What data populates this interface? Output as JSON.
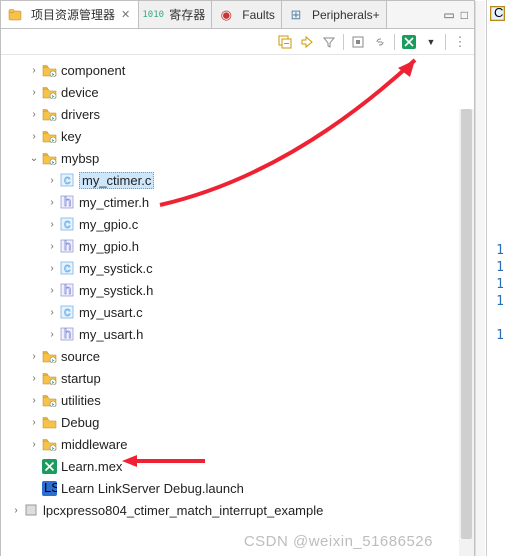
{
  "tabs": [
    {
      "label": "项目资源管理器",
      "active": true
    },
    {
      "label": "寄存器",
      "active": false
    },
    {
      "label": "Faults",
      "active": false
    },
    {
      "label": "Peripherals+",
      "active": false
    }
  ],
  "tree": {
    "folders_top": [
      {
        "name": "component",
        "indent": 1
      },
      {
        "name": "device",
        "indent": 1
      },
      {
        "name": "drivers",
        "indent": 1
      },
      {
        "name": "key",
        "indent": 1
      }
    ],
    "mybsp": {
      "name": "mybsp",
      "indent": 1
    },
    "mybsp_files": [
      {
        "name": "my_ctimer.c",
        "type": "c",
        "selected": true
      },
      {
        "name": "my_ctimer.h",
        "type": "h"
      },
      {
        "name": "my_gpio.c",
        "type": "c"
      },
      {
        "name": "my_gpio.h",
        "type": "h"
      },
      {
        "name": "my_systick.c",
        "type": "c"
      },
      {
        "name": "my_systick.h",
        "type": "h"
      },
      {
        "name": "my_usart.c",
        "type": "c"
      },
      {
        "name": "my_usart.h",
        "type": "h"
      }
    ],
    "folders_mid": [
      {
        "name": "source",
        "indent": 1
      },
      {
        "name": "startup",
        "indent": 1
      },
      {
        "name": "utilities",
        "indent": 1
      },
      {
        "name": "Debug",
        "indent": 1,
        "plain": true
      },
      {
        "name": "middleware",
        "indent": 1
      }
    ],
    "leaves": [
      {
        "name": "Learn.mex",
        "type": "mex",
        "indent": 1
      },
      {
        "name": "Learn LinkServer Debug.launch",
        "type": "ls",
        "indent": 1
      }
    ],
    "bottom_project": "lpcxpresso804_ctimer_match_interrupt_example"
  },
  "gutter_lines": [
    "1",
    "1",
    "1",
    "1",
    "",
    "1"
  ],
  "watermark": "CSDN @weixin_51686526"
}
